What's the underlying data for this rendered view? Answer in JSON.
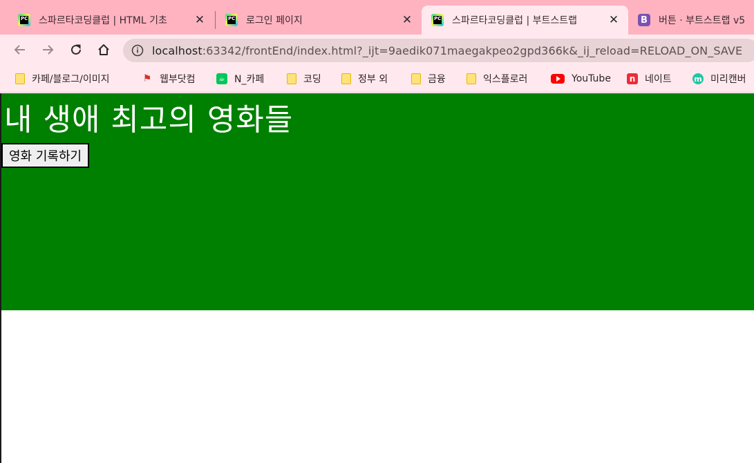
{
  "tabs": [
    {
      "title": "스파르타코딩클럽 | HTML 기초",
      "icon": "pycharm-icon",
      "active": false
    },
    {
      "title": "로그인 페이지",
      "icon": "pycharm-icon",
      "active": false
    },
    {
      "title": "스파르타코딩클럽 | 부트스트랩 ",
      "icon": "pycharm-icon",
      "active": true
    },
    {
      "title": "버튼 · 부트스트랩 v5",
      "icon": "bootstrap-icon",
      "active": false,
      "icon_letter": "B"
    }
  ],
  "toolbar": {
    "url_host": "localhost",
    "url_rest": ":63342/frontEnd/index.html?_ijt=9aedik071maegakpeo2gpd366k&_ij_reload=RELOAD_ON_SAVE"
  },
  "bookmarks": [
    {
      "label": "카페/블로그/이미지",
      "icon": "folder-icon"
    },
    {
      "label": "웹부닷컴",
      "icon": "flag-icon"
    },
    {
      "label": "N_카페",
      "icon": "naver-cafe-icon"
    },
    {
      "label": "코딩",
      "icon": "folder-icon"
    },
    {
      "label": "정부 외",
      "icon": "folder-icon"
    },
    {
      "label": "금융",
      "icon": "folder-icon"
    },
    {
      "label": "익스플로러",
      "icon": "folder-icon"
    },
    {
      "label": "YouTube",
      "icon": "youtube-icon"
    },
    {
      "label": "네이트",
      "icon": "nate-icon",
      "icon_letter": "n"
    },
    {
      "label": "미리캔버",
      "icon": "miricanvas-icon",
      "icon_letter": "m"
    }
  ],
  "page": {
    "title": "내 생애 최고의 영화들",
    "button_label": "영화 기록하기",
    "hero_color": "#008000"
  },
  "colors": {
    "tabstrip": "#ffb3c1",
    "toolbar": "#ffe9ee",
    "omnibox": "#e8d3d7"
  }
}
